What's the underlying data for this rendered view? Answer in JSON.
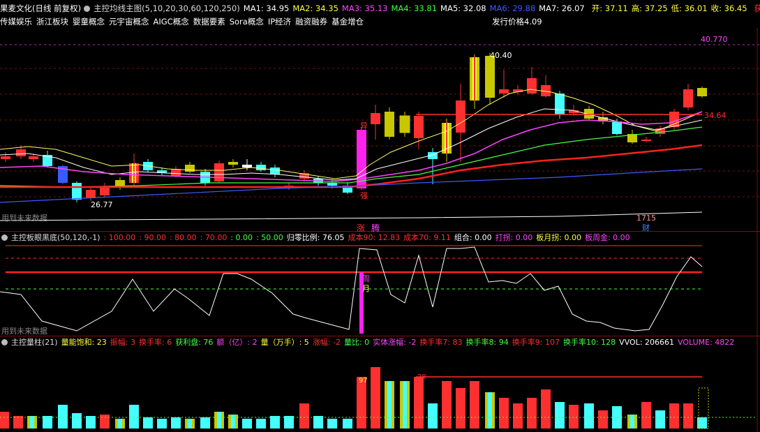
{
  "header": {
    "title": "果麦文化(日线 前复权)",
    "indicator": "主控均线主图",
    "params": "(5,10,20,30,60,120,250)",
    "ma": [
      {
        "label": "MA1: 34.95",
        "color": "#ffffff"
      },
      {
        "label": "MA2: 34.35",
        "color": "#ffff3c"
      },
      {
        "label": "MA3: 35.13",
        "color": "#ff44ff"
      },
      {
        "label": "MA4: 33.81",
        "color": "#44ff44"
      },
      {
        "label": "MA5: 32.08",
        "color": "#ffffff"
      },
      {
        "label": "MA6: 29.88",
        "color": "#3a5bff"
      },
      {
        "label": "MA7: 26.07",
        "color": "#ffffff"
      }
    ],
    "quote": [
      {
        "label": "开: 37.11",
        "color": "#ffff3c"
      },
      {
        "label": "高: 37.25",
        "color": "#ffff3c"
      },
      {
        "label": "低: 36.01",
        "color": "#ffff3c"
      },
      {
        "label": "收: 36.45",
        "color": "#ffff3c"
      }
    ],
    "profit": "获利◇"
  },
  "concepts": {
    "items": [
      "传媒娱乐",
      "浙江板块",
      "婴童概念",
      "元宇宙概念",
      "AIGC概念",
      "数据要素",
      "Sora概念",
      "IP经济",
      "融资融券",
      "基金增仓"
    ],
    "issue_price": "发行价格4.09"
  },
  "main_panel": {
    "high_label": "40.770",
    "peak_label": "40.40",
    "low_label": "26.77",
    "level_label": "34.64",
    "future_text": "用到未来数据",
    "tag_rise": "异",
    "tag_strong": "强",
    "tag_zhang": "涨",
    "tag_teng": "腾",
    "tag_date": "1715",
    "tag_cai": "财"
  },
  "panel2": {
    "name": "主控板眼黑底",
    "params": "(50,120,-1)",
    "values": [
      {
        "label": ": 100.00",
        "color": "#ff3030"
      },
      {
        "label": ": 90.00",
        "color": "#ff3030"
      },
      {
        "label": ": 80.00",
        "color": "#ff3030"
      },
      {
        "label": ": 70.00",
        "color": "#ff3030"
      },
      {
        "label": ": 0.00",
        "color": "#44ff44"
      },
      {
        "label": ": 50.00",
        "color": "#44ff44"
      },
      {
        "label": "归零比例: 76.05",
        "color": "#ffffff"
      },
      {
        "label": "成本90: 12.83",
        "color": "#ff3030"
      },
      {
        "label": "成本70: 9.11",
        "color": "#ff3030"
      },
      {
        "label": "组合: 0.00",
        "color": "#ffffff"
      },
      {
        "label": "打拐: 0.00",
        "color": "#ff44ff"
      },
      {
        "label": "板月拐: 0.00",
        "color": "#ffff3c"
      },
      {
        "label": "板周金: 0.00",
        "color": "#ff44ff"
      }
    ],
    "tag1": "周",
    "tag2": "月",
    "future_text": "用到未来数据"
  },
  "panel3": {
    "name": "主控量柱",
    "params": "(21)",
    "values": [
      {
        "label": "量能饱和: 23",
        "color": "#ffff3c"
      },
      {
        "label": "振幅: 3",
        "color": "#ff3030"
      },
      {
        "label": "换手率: 6",
        "color": "#ff3030"
      },
      {
        "label": "获利盘: 76",
        "color": "#44ff44"
      },
      {
        "label": "额（亿）: 2",
        "color": "#ff44ff"
      },
      {
        "label": "量（万手）: 5",
        "color": "#ffff3c"
      },
      {
        "label": "涨幅: -2",
        "color": "#ff3030"
      },
      {
        "label": "量比: 0",
        "color": "#44ff44"
      },
      {
        "label": "实体涨幅: -2",
        "color": "#ff44ff"
      },
      {
        "label": "换手率7: 83",
        "color": "#ff3030"
      },
      {
        "label": "换手率8: 94",
        "color": "#44ff44"
      },
      {
        "label": "换手率9: 107",
        "color": "#ff3030"
      },
      {
        "label": "换手率10: 128",
        "color": "#44ff44"
      },
      {
        "label": "VVOL: 206661",
        "color": "#ffffff"
      },
      {
        "label": "VOLUME: 4822",
        "color": "#ff44ff"
      }
    ],
    "tag_a": "97",
    "tag_b": "28"
  }
}
